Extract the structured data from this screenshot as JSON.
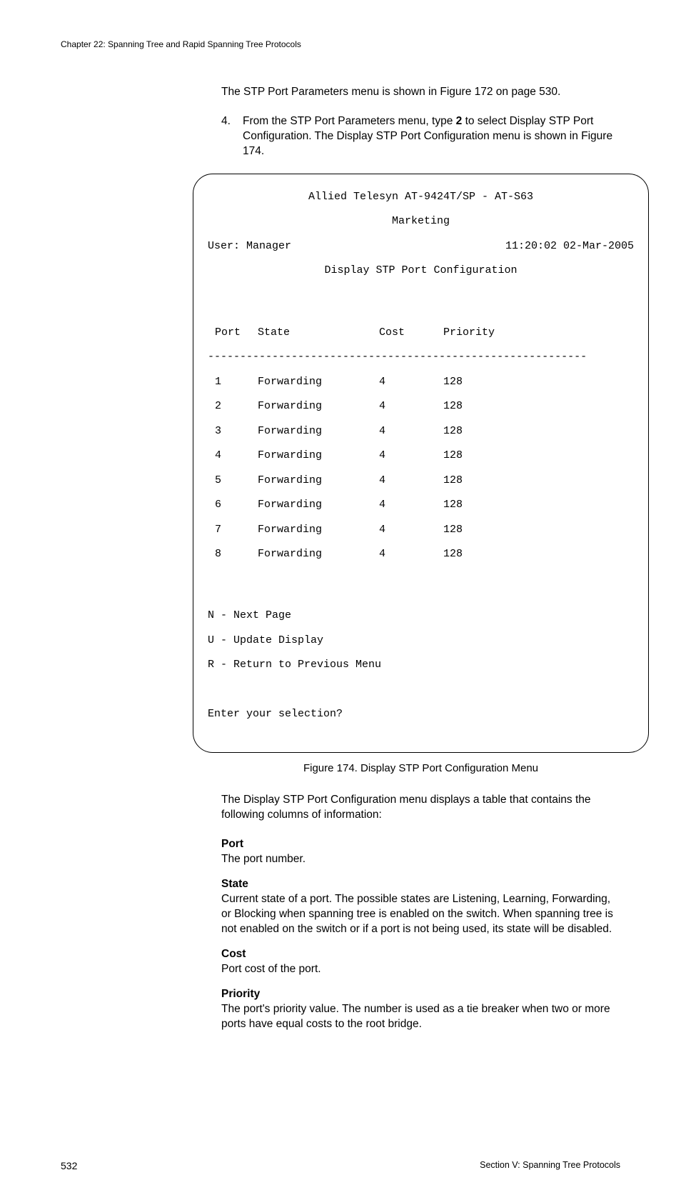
{
  "header": {
    "chapter": "Chapter 22: Spanning Tree and Rapid Spanning Tree Protocols"
  },
  "body": {
    "intro": "The STP Port Parameters menu is shown in Figure 172 on page 530.",
    "step": {
      "num": "4.",
      "text_a": "From the STP Port Parameters menu, type ",
      "bold": "2",
      "text_b": " to select Display STP Port Configuration. The Display STP Port Configuration menu is shown in Figure 174."
    }
  },
  "terminal": {
    "title": "Allied Telesyn AT-9424T/SP - AT-S63",
    "subtitle": "Marketing",
    "user": "User: Manager",
    "timestamp": "11:20:02 02-Mar-2005",
    "menu_title": "Display STP Port Configuration",
    "cols": {
      "port": "Port",
      "state": "State",
      "cost": "Cost",
      "prio": "Priority"
    },
    "divider": "-----------------------------------------------------------",
    "rows": [
      {
        "port": "1",
        "state": "Forwarding",
        "cost": "4",
        "prio": "128"
      },
      {
        "port": "2",
        "state": "Forwarding",
        "cost": "4",
        "prio": "128"
      },
      {
        "port": "3",
        "state": "Forwarding",
        "cost": "4",
        "prio": "128"
      },
      {
        "port": "4",
        "state": "Forwarding",
        "cost": "4",
        "prio": "128"
      },
      {
        "port": "5",
        "state": "Forwarding",
        "cost": "4",
        "prio": "128"
      },
      {
        "port": "6",
        "state": "Forwarding",
        "cost": "4",
        "prio": "128"
      },
      {
        "port": "7",
        "state": "Forwarding",
        "cost": "4",
        "prio": "128"
      },
      {
        "port": "8",
        "state": "Forwarding",
        "cost": "4",
        "prio": "128"
      }
    ],
    "opts": {
      "n": "N - Next Page",
      "u": "U - Update Display",
      "r": "R - Return to Previous Menu"
    },
    "prompt": "Enter your selection?"
  },
  "caption": "Figure 174. Display STP Port Configuration Menu",
  "after": {
    "lead": "The Display STP Port Configuration menu displays a table that contains the following columns of information:",
    "defs": [
      {
        "term": "Port",
        "text": "The port number."
      },
      {
        "term": "State",
        "text": "Current state of a port. The possible states are Listening, Learning, Forwarding, or Blocking when spanning tree is enabled on the switch. When spanning tree is not enabled on the switch or if a port is not being used, its state will be disabled."
      },
      {
        "term": "Cost",
        "text": "Port cost of the port."
      },
      {
        "term": "Priority",
        "text": "The port's priority value. The number is used as a tie breaker when two or more ports have equal costs to the root bridge."
      }
    ]
  },
  "footer": {
    "page": "532",
    "section": "Section V: Spanning Tree Protocols"
  }
}
